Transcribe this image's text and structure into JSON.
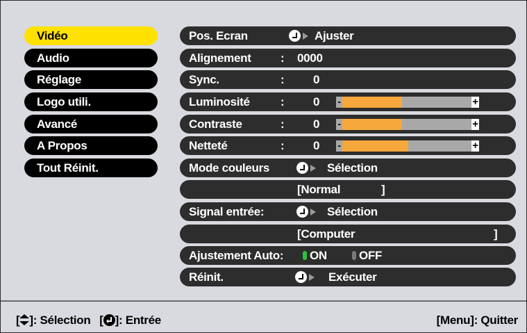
{
  "menu": {
    "items": [
      {
        "label": "Vidéo",
        "active": true
      },
      {
        "label": "Audio",
        "active": false
      },
      {
        "label": "Réglage",
        "active": false
      },
      {
        "label": "Logo utili.",
        "active": false
      },
      {
        "label": "Avancé",
        "active": false
      },
      {
        "label": "A Propos",
        "active": false
      },
      {
        "label": "Tout Réinit.",
        "active": false
      }
    ]
  },
  "settings": {
    "pos_ecran": {
      "label": "Pos. Ecran",
      "action": "Ajuster"
    },
    "alignement": {
      "label": "Alignement",
      "colon": ":",
      "value": "0000"
    },
    "sync": {
      "label": "Sync.",
      "colon": ":",
      "value": "0"
    },
    "luminosite": {
      "label": "Luminosité",
      "colon": ":",
      "value": "0",
      "level_fraction": 0.46,
      "minus": "-",
      "plus": "+"
    },
    "contraste": {
      "label": "Contraste",
      "colon": ":",
      "value": "0",
      "level_fraction": 0.46,
      "minus": "-",
      "plus": "+"
    },
    "nettete": {
      "label": "Netteté",
      "colon": ":",
      "value": "0",
      "level_fraction": 0.51,
      "minus": "-",
      "plus": "+"
    },
    "mode_couleurs": {
      "label": "Mode couleurs",
      "action": "Sélection",
      "current_open": "[Normal",
      "current_close": "]"
    },
    "signal_entree": {
      "label": "Signal entrée:",
      "action": "Sélection",
      "current_open": "[Computer",
      "current_close": "]"
    },
    "ajustement_auto": {
      "label": "Ajustement Auto:",
      "on_label": "ON",
      "off_label": "OFF",
      "state": "ON"
    },
    "reinit": {
      "label": "Réinit.",
      "action": "Exécuter"
    }
  },
  "footer": {
    "sel_open": "[",
    "sel_close": "]: Sélection",
    "enter_open": "[",
    "enter_close": "]: Entrée",
    "quit": "[Menu]: Quitter"
  },
  "colors": {
    "active_menu": "#ffe100",
    "slider_fill": "#f7a83c",
    "on_indicator": "#2ec23a"
  },
  "icons": [
    "enter-icon",
    "arrow-right-icon",
    "up-down-arrow-icon",
    "toggle-on-icon",
    "toggle-off-icon"
  ]
}
